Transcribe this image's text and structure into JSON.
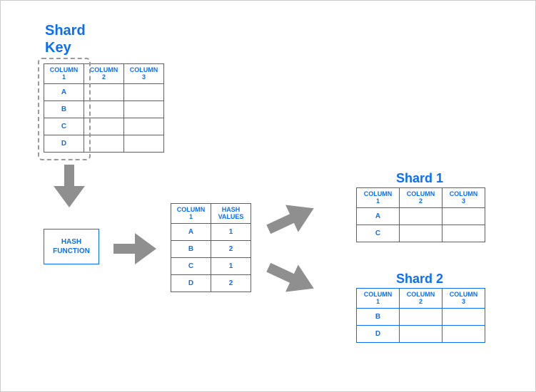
{
  "titles": {
    "shard_key": "Shard\nKey",
    "shard1": "Shard 1",
    "shard2": "Shard 2"
  },
  "hash_function_label": "HASH\nFUNCTION",
  "source_table": {
    "headers": [
      "COLUMN\n1",
      "COLUMN\n2",
      "COLUMN\n3"
    ],
    "rows": [
      [
        "A",
        "",
        ""
      ],
      [
        "B",
        "",
        ""
      ],
      [
        "C",
        "",
        ""
      ],
      [
        "D",
        "",
        ""
      ]
    ]
  },
  "hash_table": {
    "headers": [
      "COLUMN\n1",
      "HASH\nVALUES"
    ],
    "rows": [
      [
        "A",
        "1"
      ],
      [
        "B",
        "2"
      ],
      [
        "C",
        "1"
      ],
      [
        "D",
        "2"
      ]
    ]
  },
  "shard1_table": {
    "headers": [
      "COLUMN\n1",
      "COLUMN\n2",
      "COLUMN\n3"
    ],
    "rows": [
      [
        "A",
        "",
        ""
      ],
      [
        "C",
        "",
        ""
      ]
    ]
  },
  "shard2_table": {
    "headers": [
      "COLUMN\n1",
      "COLUMN\n2",
      "COLUMN\n3"
    ],
    "rows": [
      [
        "B",
        "",
        ""
      ],
      [
        "D",
        "",
        ""
      ]
    ]
  }
}
